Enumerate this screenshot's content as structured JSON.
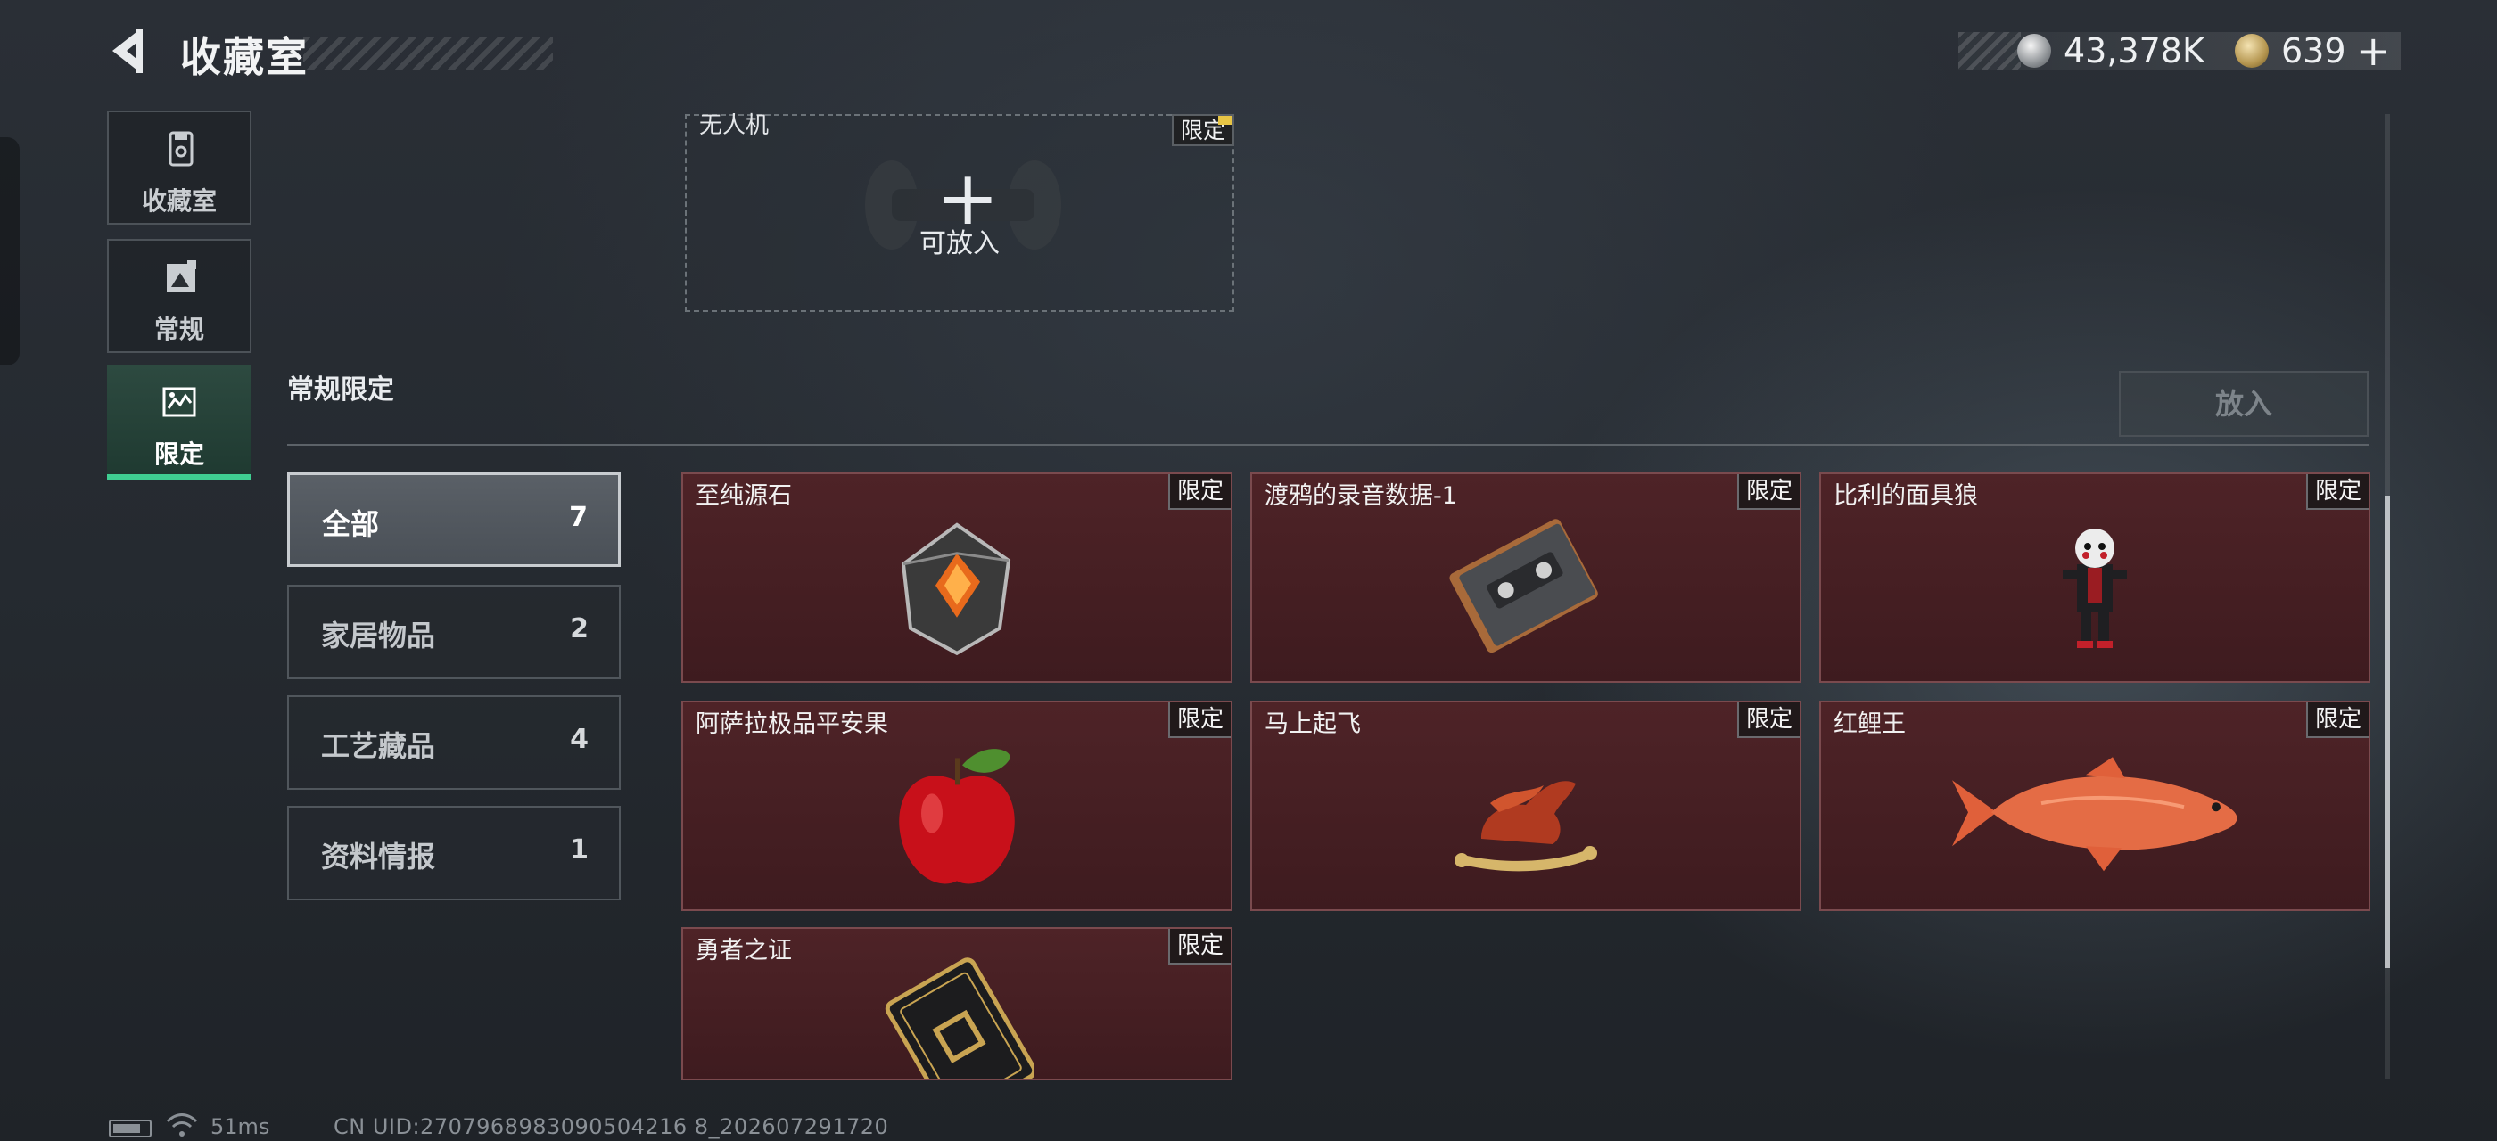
{
  "header": {
    "title": "收藏室",
    "currency": {
      "silver_value": "43,378K",
      "gold_value": "639",
      "add_label": "+"
    }
  },
  "sidebar": {
    "items": [
      {
        "label": "收藏室",
        "icon": "collection-room-icon"
      },
      {
        "label": "常规",
        "icon": "regular-icon"
      },
      {
        "label": "限定",
        "icon": "limited-icon",
        "active": true
      }
    ]
  },
  "drone_slot": {
    "label": "无人机",
    "tag": "限定",
    "hint": "可放入",
    "plus": "+"
  },
  "section": {
    "title": "常规限定",
    "place_button": "放入"
  },
  "categories": [
    {
      "label": "全部",
      "count": "7",
      "active": true
    },
    {
      "label": "家居物品",
      "count": "2"
    },
    {
      "label": "工艺藏品",
      "count": "4"
    },
    {
      "label": "资料情报",
      "count": "1"
    }
  ],
  "items": [
    {
      "name": "至纯源石",
      "tag": "限定",
      "icon": "crystal-stone-icon"
    },
    {
      "name": "渡鸦的录音数据-1",
      "tag": "限定",
      "icon": "cassette-tape-icon"
    },
    {
      "name": "比利的面具狼",
      "tag": "限定",
      "icon": "puppet-doll-icon"
    },
    {
      "name": "阿萨拉极品平安果",
      "tag": "限定",
      "icon": "apple-icon"
    },
    {
      "name": "马上起飞",
      "tag": "限定",
      "icon": "horse-figurine-icon"
    },
    {
      "name": "红鲤王",
      "tag": "限定",
      "icon": "koi-fish-icon"
    },
    {
      "name": "勇者之证",
      "tag": "限定",
      "icon": "card-emblem-icon"
    }
  ],
  "status_bar": {
    "ping": "51ms",
    "uid": "CN UID:2707968983090504216 8_202607291720"
  },
  "colors": {
    "accent_green": "#3fcf92",
    "item_card_red": "#4e2327"
  }
}
